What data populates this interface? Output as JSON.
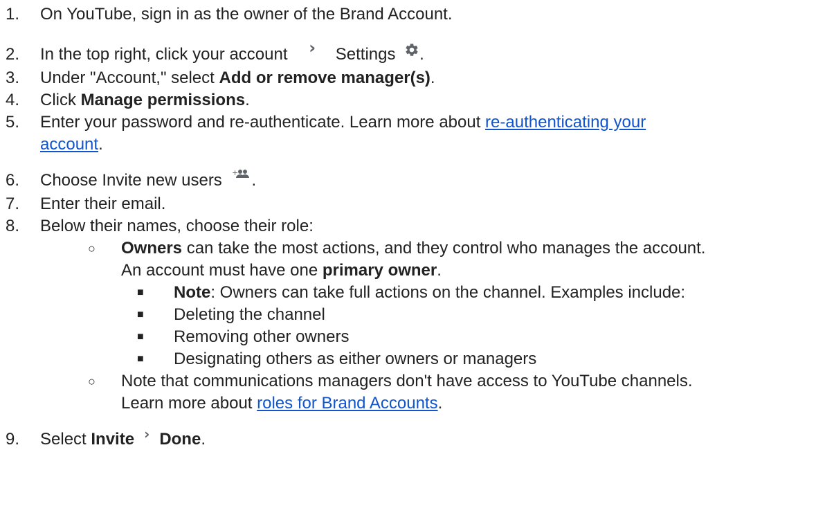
{
  "steps": [
    {
      "num": "1.",
      "text": "On YouTube, sign in as the owner of the Brand Account."
    },
    {
      "num": "2.",
      "pre": "In the top right, click your account",
      "settings": "Settings",
      "post": "."
    },
    {
      "num": "3.",
      "pre": "Under \"Account,\" select ",
      "bold": "Add or remove manager(s)",
      "post": "."
    },
    {
      "num": "4.",
      "pre": "Click ",
      "bold": "Manage permissions",
      "post": "."
    },
    {
      "num": "5.",
      "pre": "Enter your password and re-authenticate. Learn more about ",
      "link1": "re-authenticating your",
      "link2": "account",
      "post": "."
    },
    {
      "num": "6.",
      "pre": "Choose Invite new users",
      "post": "."
    },
    {
      "num": "7.",
      "text": "Enter their email."
    },
    {
      "num": "8.",
      "text": "Below their names, choose their role:"
    },
    {
      "num": "9.",
      "pre": "Select ",
      "bold1": "Invite",
      "bold2": "Done",
      "post": "."
    }
  ],
  "roles": {
    "owners": {
      "bullet": "○",
      "bold": "Owners",
      "rest": " can take the most actions, and they control who manages the account.",
      "line2_pre": "An account must have one ",
      "line2_bold": "primary owner",
      "line2_post": "."
    },
    "owner_sub": [
      {
        "bullet": "■",
        "bold": "Note",
        "rest": ": Owners can take full actions on the channel. Examples include:"
      },
      {
        "bullet": "■",
        "text": "Deleting the channel"
      },
      {
        "bullet": "■",
        "text": "Removing other owners"
      },
      {
        "bullet": "■",
        "text": "Designating others as either owners or managers"
      }
    ],
    "comms": {
      "bullet": "○",
      "line1": "Note that communications managers don't have access to YouTube channels.",
      "line2_pre": "Learn more about ",
      "line2_link": "roles for Brand Accounts",
      "line2_post": "."
    }
  },
  "icons": {
    "chevron": "›",
    "gear": "gear-icon",
    "add_people": "person-add-icon"
  }
}
